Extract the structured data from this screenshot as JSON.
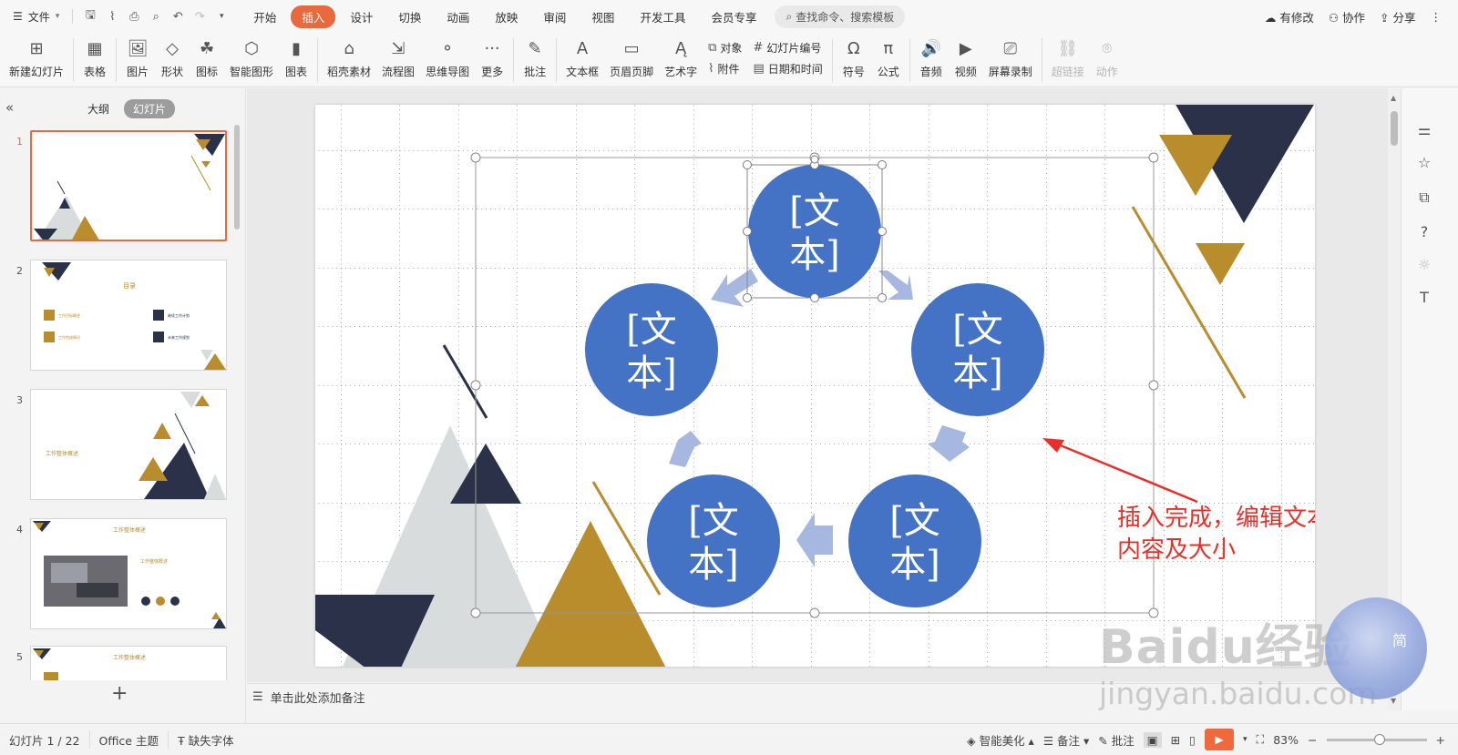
{
  "menubar": {
    "file_label": "文件",
    "tabs": [
      {
        "label": "开始"
      },
      {
        "label": "插入"
      },
      {
        "label": "设计"
      },
      {
        "label": "切换"
      },
      {
        "label": "动画"
      },
      {
        "label": "放映"
      },
      {
        "label": "审阅"
      },
      {
        "label": "视图"
      },
      {
        "label": "开发工具"
      },
      {
        "label": "会员专享"
      }
    ],
    "active_tab": "插入",
    "search_placeholder": "查找命令、搜索模板",
    "right": {
      "modified": "有修改",
      "collab": "协作",
      "share": "分享"
    }
  },
  "ribbon": {
    "new_slide": "新建幻灯片",
    "table": "表格",
    "picture": "图片",
    "shape": "形状",
    "icon": "图标",
    "smartart": "智能图形",
    "chart": "图表",
    "material": "稻壳素材",
    "flowchart": "流程图",
    "mindmap": "思维导图",
    "more": "更多",
    "comment": "批注",
    "textbox": "文本框",
    "header_footer": "页眉页脚",
    "wordart": "艺术字",
    "object": "对象",
    "attachment": "附件",
    "slide_number": "幻灯片编号",
    "datetime": "日期和时间",
    "symbol": "符号",
    "formula": "公式",
    "audio": "音频",
    "video": "视频",
    "screen_record": "屏幕录制",
    "hyperlink": "超链接",
    "animation": "动作"
  },
  "leftpanel": {
    "outline_label": "大纲",
    "slides_label": "幻灯片",
    "slide_numbers": [
      "1",
      "2",
      "3",
      "4",
      "5"
    ],
    "thumb2": {
      "title": "目录",
      "items": [
        "工作目标概述",
        "工作完成情况",
        "继续工作计划",
        "未来工作规划"
      ]
    },
    "thumb3": {
      "title": "工作整体概述"
    },
    "thumb4": {
      "title": "工作整体概述",
      "subtitle": "工作整体概述"
    },
    "thumb5": {
      "title": "工作整体概述"
    }
  },
  "slide": {
    "circle_text_line1": "[文",
    "circle_text_line2": "本]",
    "annotation_line1": "插入完成，编辑文本",
    "annotation_line2": "内容及大小"
  },
  "notes_placeholder": "单击此处添加备注",
  "statusbar": {
    "slide_count": "幻灯片 1 / 22",
    "theme": "Office 主题",
    "missing_font": "缺失字体",
    "smart_beautify": "智能美化",
    "notes": "备注",
    "comments": "批注",
    "zoom": "83%"
  },
  "watermark": {
    "brand": "Baidu经验",
    "url": "jingyan.baidu.com",
    "badge": "简"
  },
  "colors": {
    "accent": "#e8693b",
    "circle": "#4472c4",
    "arrow": "#a6b8e0",
    "navy": "#2a3148",
    "gold": "#b98c2c",
    "grey": "#d9dcdd",
    "annotation": "#e8302a"
  }
}
